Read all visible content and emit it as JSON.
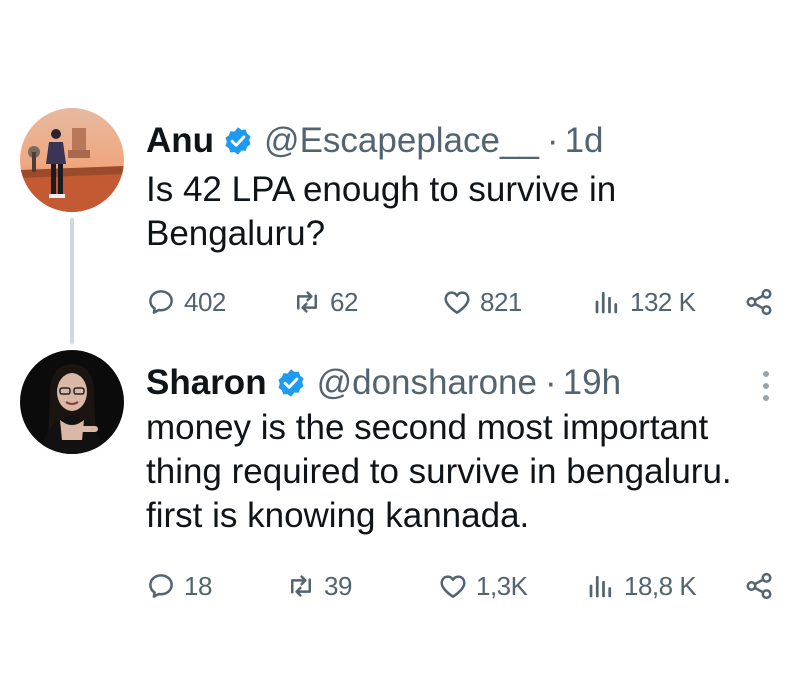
{
  "tweets": [
    {
      "name": "Anu",
      "handle": "@Escapeplace__",
      "separator": "·",
      "time": "1d",
      "text_lines": [
        "Is 42 LPA enough to survive in",
        "Bengaluru?"
      ],
      "stats": {
        "replies": "402",
        "retweets": "62",
        "likes": "821",
        "views": "132 K"
      }
    },
    {
      "name": "Sharon",
      "handle": "@donsharone",
      "separator": "·",
      "time": "19h",
      "text_lines": [
        "money is the second most important",
        "thing required to survive in bengaluru.",
        "first is knowing kannada."
      ],
      "stats": {
        "replies": "18",
        "retweets": "39",
        "likes": "1,3K",
        "views": "18,8 K"
      }
    }
  ],
  "colors": {
    "text": "#0f1419",
    "muted": "#536471",
    "verified": "#1d9bf0",
    "thread_line": "#cfd9de"
  },
  "icons": [
    "verified-badge-icon",
    "reply-icon",
    "retweet-icon",
    "like-icon",
    "views-icon",
    "share-icon",
    "more-icon"
  ]
}
